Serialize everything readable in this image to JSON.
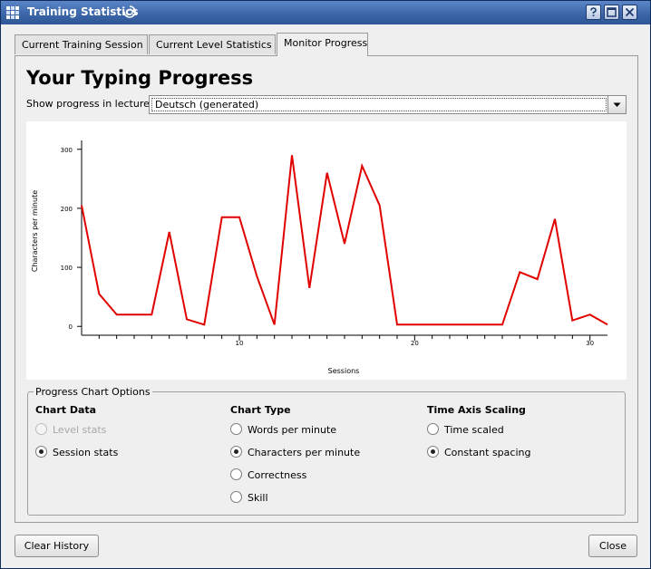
{
  "window": {
    "title": "Training Statistics"
  },
  "tabs": [
    {
      "label": "Current Training Session",
      "active": false
    },
    {
      "label": "Current Level Statistics",
      "active": false
    },
    {
      "label": "Monitor Progress",
      "active": true
    }
  ],
  "main": {
    "heading": "Your Typing Progress",
    "lecture_label": "Show progress in lecture:",
    "lecture_value": "Deutsch (generated)"
  },
  "chart_data": {
    "type": "line",
    "xlabel": "Sessions",
    "ylabel": "Characters per minute",
    "xlim": [
      1,
      31
    ],
    "ylim": [
      -15,
      315
    ],
    "xticks": [
      10,
      20,
      30
    ],
    "yticks": [
      0,
      100,
      200,
      300
    ],
    "series": [
      {
        "color": "#e00000",
        "x": [
          1,
          2,
          3,
          4,
          5,
          6,
          7,
          8,
          9,
          10,
          11,
          12,
          13,
          14,
          15,
          16,
          17,
          18,
          19,
          20,
          21,
          22,
          23,
          24,
          25,
          26,
          27,
          28,
          29,
          30,
          31
        ],
        "values": [
          205,
          55,
          20,
          20,
          20,
          160,
          12,
          3,
          185,
          185,
          85,
          3,
          290,
          65,
          260,
          140,
          272,
          205,
          3,
          3,
          3,
          3,
          3,
          3,
          3,
          92,
          80,
          182,
          10,
          20,
          3
        ]
      }
    ],
    "grid": false,
    "legend": "none"
  },
  "options": {
    "title": "Progress Chart Options",
    "chart_data_group": {
      "title": "Chart Data",
      "items": [
        {
          "label": "Level stats",
          "checked": false,
          "disabled": true
        },
        {
          "label": "Session stats",
          "checked": true,
          "disabled": false
        }
      ]
    },
    "chart_type_group": {
      "title": "Chart Type",
      "items": [
        {
          "label": "Words per minute",
          "checked": false
        },
        {
          "label": "Characters per minute",
          "checked": true
        },
        {
          "label": "Correctness",
          "checked": false
        },
        {
          "label": "Skill",
          "checked": false
        }
      ]
    },
    "time_axis_group": {
      "title": "Time Axis Scaling",
      "items": [
        {
          "label": "Time scaled",
          "checked": false
        },
        {
          "label": "Constant spacing",
          "checked": true
        }
      ]
    }
  },
  "footer": {
    "clear_label": "Clear History",
    "close_label": "Close"
  },
  "colors": {
    "titlebar": "#3c66a8",
    "series": "#e00000"
  }
}
